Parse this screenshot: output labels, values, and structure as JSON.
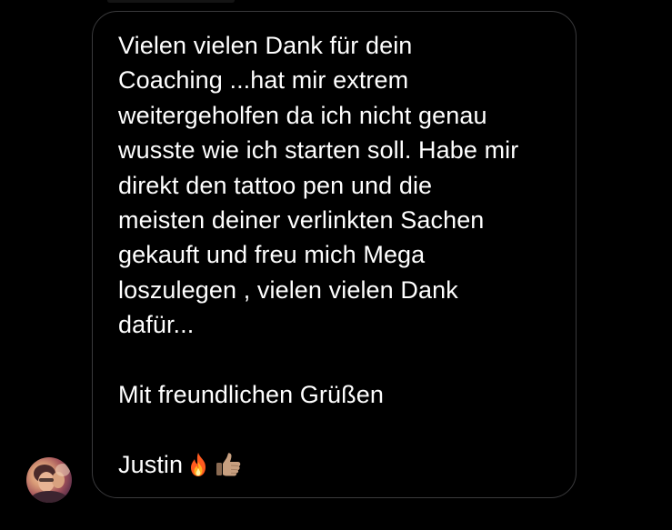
{
  "message": {
    "lines": [
      "Vielen vielen Dank für dein",
      "Coaching ...hat mir extrem",
      "weitergeholfen da ich nicht genau",
      "wusste wie ich starten soll. Habe mir",
      "direkt den tattoo pen und die",
      "meisten deiner verlinkten Sachen",
      "gekauft und freu mich Mega",
      "loszulegen , vielen vielen Dank",
      "dafür..."
    ],
    "closing": "Mit freundlichen Grüßen",
    "signature": "Justin",
    "emojis": [
      "fire-emoji",
      "thumbs-up-emoji"
    ]
  },
  "colors": {
    "background": "#000000",
    "bubble_border": "#3a3a3c",
    "text": "#ffffff"
  }
}
